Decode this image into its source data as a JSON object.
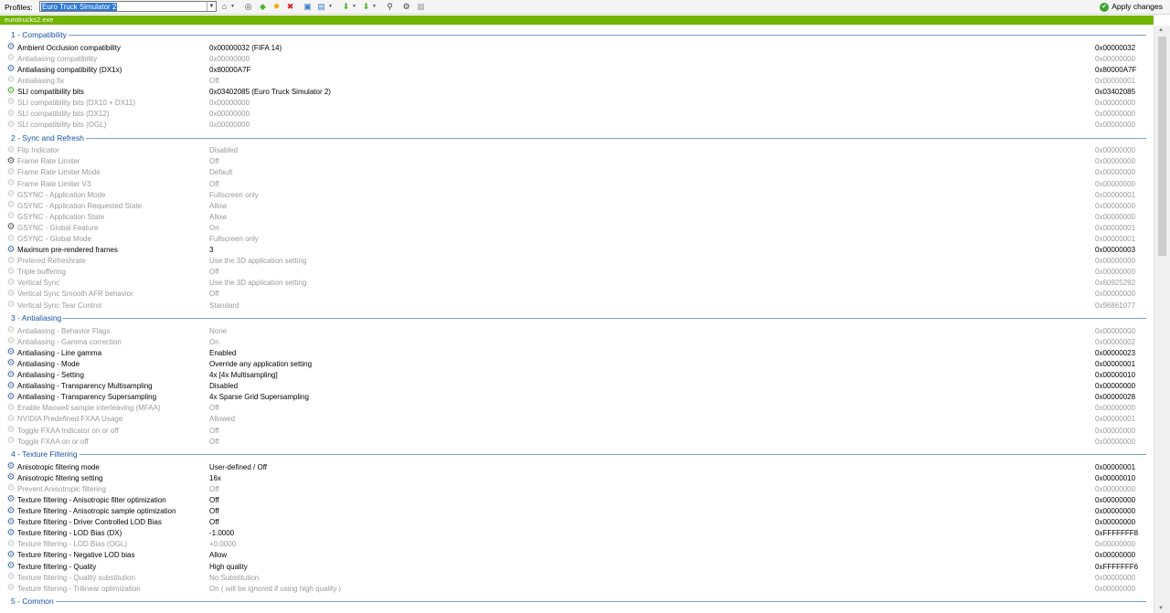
{
  "toolbar": {
    "profiles_label": "Profiles:",
    "profile_value": "Euro Truck Simulator 2",
    "apply_label": "Apply changes",
    "icons": [
      "home-icon",
      "scan-icon",
      "add-app-icon",
      "sun-icon",
      "delete-icon",
      "settings-icon",
      "export-icon",
      "import-icon",
      "filter-icon",
      "search-icon",
      "grid-icon"
    ]
  },
  "exe_name": "eurotrucks2.exe",
  "sections": [
    {
      "title": "1 - Compatibility",
      "rows": [
        {
          "name": "Ambient Occlusion compatibility",
          "value": "0x00000032 (FIFA 14)",
          "hex": "0x00000032",
          "active": true
        },
        {
          "name": "Antialiasing compatibility",
          "value": "0x00000000",
          "hex": "0x00000000",
          "active": false
        },
        {
          "name": "Antialiasing compatibility (DX1x)",
          "value": "0x80000A7F",
          "hex": "0x80000A7F",
          "active": true
        },
        {
          "name": "Antialiasing fix",
          "value": "Off",
          "hex": "0x00000001",
          "active": false
        },
        {
          "name": "SLI compatibility bits",
          "value": "0x03402085 (Euro Truck Simulator 2)",
          "hex": "0x03402085",
          "active": true,
          "highlight": true
        },
        {
          "name": "SLI compatibility bits (DX10 + DX11)",
          "value": "0x00000000",
          "hex": "0x00000000",
          "active": false
        },
        {
          "name": "SLI compatibility bits (DX12)",
          "value": "0x00000000",
          "hex": "0x00000000",
          "active": false
        },
        {
          "name": "SLI compatibility bits (OGL)",
          "value": "0x00000000",
          "hex": "0x00000000",
          "active": false
        }
      ]
    },
    {
      "title": "2 - Sync and Refresh",
      "rows": [
        {
          "name": "Flip Indicator",
          "value": "Disabled",
          "hex": "0x00000000",
          "active": false
        },
        {
          "name": "Frame Rate Limiter",
          "value": "Off",
          "hex": "0x00000000",
          "active": false,
          "dark": true
        },
        {
          "name": "Frame Rate Limiter Mode",
          "value": "Default",
          "hex": "0x00000000",
          "active": false
        },
        {
          "name": "Frame Rate Limiter V3",
          "value": "Off",
          "hex": "0x00000000",
          "active": false
        },
        {
          "name": "GSYNC - Application Mode",
          "value": "Fullscreen only",
          "hex": "0x00000001",
          "active": false
        },
        {
          "name": "GSYNC - Application Requested State",
          "value": "Allow",
          "hex": "0x00000000",
          "active": false
        },
        {
          "name": "GSYNC - Application State",
          "value": "Allow",
          "hex": "0x00000000",
          "active": false
        },
        {
          "name": "GSYNC - Global Feature",
          "value": "On",
          "hex": "0x00000001",
          "active": false,
          "dark": true
        },
        {
          "name": "GSYNC - Global Mode",
          "value": "Fullscreen only",
          "hex": "0x00000001",
          "active": false
        },
        {
          "name": "Maximum pre-rendered frames",
          "value": "3",
          "hex": "0x00000003",
          "active": true
        },
        {
          "name": "Prefered Refreshrate",
          "value": "Use the 3D application setting",
          "hex": "0x00000000",
          "active": false
        },
        {
          "name": "Triple buffering",
          "value": "Off",
          "hex": "0x00000000",
          "active": false
        },
        {
          "name": "Vertical Sync",
          "value": "Use the 3D application setting",
          "hex": "0x60925292",
          "active": false
        },
        {
          "name": "Vertical Sync Smooth AFR behavior",
          "value": "Off",
          "hex": "0x00000000",
          "active": false
        },
        {
          "name": "Vertical Sync Tear Control",
          "value": "Standard",
          "hex": "0x96861077",
          "active": false
        }
      ]
    },
    {
      "title": "3 - Antialiasing",
      "rows": [
        {
          "name": "Antialiasing - Behavior Flags",
          "value": "None",
          "hex": "0x00000000",
          "active": false
        },
        {
          "name": "Antialiasing - Gamma correction",
          "value": "On",
          "hex": "0x00000002",
          "active": false
        },
        {
          "name": "Antialiasing - Line gamma",
          "value": "Enabled",
          "hex": "0x00000023",
          "active": true
        },
        {
          "name": "Antialiasing - Mode",
          "value": "Override any application setting",
          "hex": "0x00000001",
          "active": true
        },
        {
          "name": "Antialiasing - Setting",
          "value": "4x [4x Multisampling]",
          "hex": "0x00000010",
          "active": true
        },
        {
          "name": "Antialiasing - Transparency Multisampling",
          "value": "Disabled",
          "hex": "0x00000000",
          "active": true
        },
        {
          "name": "Antialiasing - Transparency Supersampling",
          "value": "4x Sparse Grid Supersampling",
          "hex": "0x00000028",
          "active": true
        },
        {
          "name": "Enable Maxwell sample interleaving (MFAA)",
          "value": "Off",
          "hex": "0x00000000",
          "active": false
        },
        {
          "name": "NVIDIA Predefined FXAA Usage",
          "value": "Allowed",
          "hex": "0x00000001",
          "active": false
        },
        {
          "name": "Toggle FXAA Indicator on or off",
          "value": "Off",
          "hex": "0x00000000",
          "active": false
        },
        {
          "name": "Toggle FXAA on or off",
          "value": "Off",
          "hex": "0x00000000",
          "active": false
        }
      ]
    },
    {
      "title": "4 - Texture Filtering",
      "rows": [
        {
          "name": "Anisotropic filtering mode",
          "value": "User-defined / Off",
          "hex": "0x00000001",
          "active": true
        },
        {
          "name": "Anisotropic filtering setting",
          "value": "16x",
          "hex": "0x00000010",
          "active": true
        },
        {
          "name": "Prevent Anisotropic filtering",
          "value": "Off",
          "hex": "0x00000000",
          "active": false
        },
        {
          "name": "Texture filtering - Anisotropic filter optimization",
          "value": "Off",
          "hex": "0x00000000",
          "active": true
        },
        {
          "name": "Texture filtering - Anisotropic sample optimization",
          "value": "Off",
          "hex": "0x00000000",
          "active": true
        },
        {
          "name": "Texture filtering - Driver Controlled LOD Bias",
          "value": "Off",
          "hex": "0x00000000",
          "active": true
        },
        {
          "name": "Texture filtering - LOD Bias (DX)",
          "value": "-1.0000",
          "hex": "0xFFFFFFF8",
          "active": true
        },
        {
          "name": "Texture filtering - LOD Bias (OGL)",
          "value": "+0.0000",
          "hex": "0x00000000",
          "active": false
        },
        {
          "name": "Texture filtering - Negative LOD bias",
          "value": "Allow",
          "hex": "0x00000000",
          "active": true
        },
        {
          "name": "Texture filtering - Quality",
          "value": "High quality",
          "hex": "0xFFFFFFF6",
          "active": true
        },
        {
          "name": "Texture filtering - Quality substitution",
          "value": "No Substitution",
          "hex": "0x00000000",
          "active": false
        },
        {
          "name": "Texture filtering - Trilinear optimization",
          "value": "On ( will be ignored if using high quality )",
          "hex": "0x00000000",
          "active": false
        }
      ]
    },
    {
      "title": "5 - Common",
      "rows": []
    }
  ]
}
